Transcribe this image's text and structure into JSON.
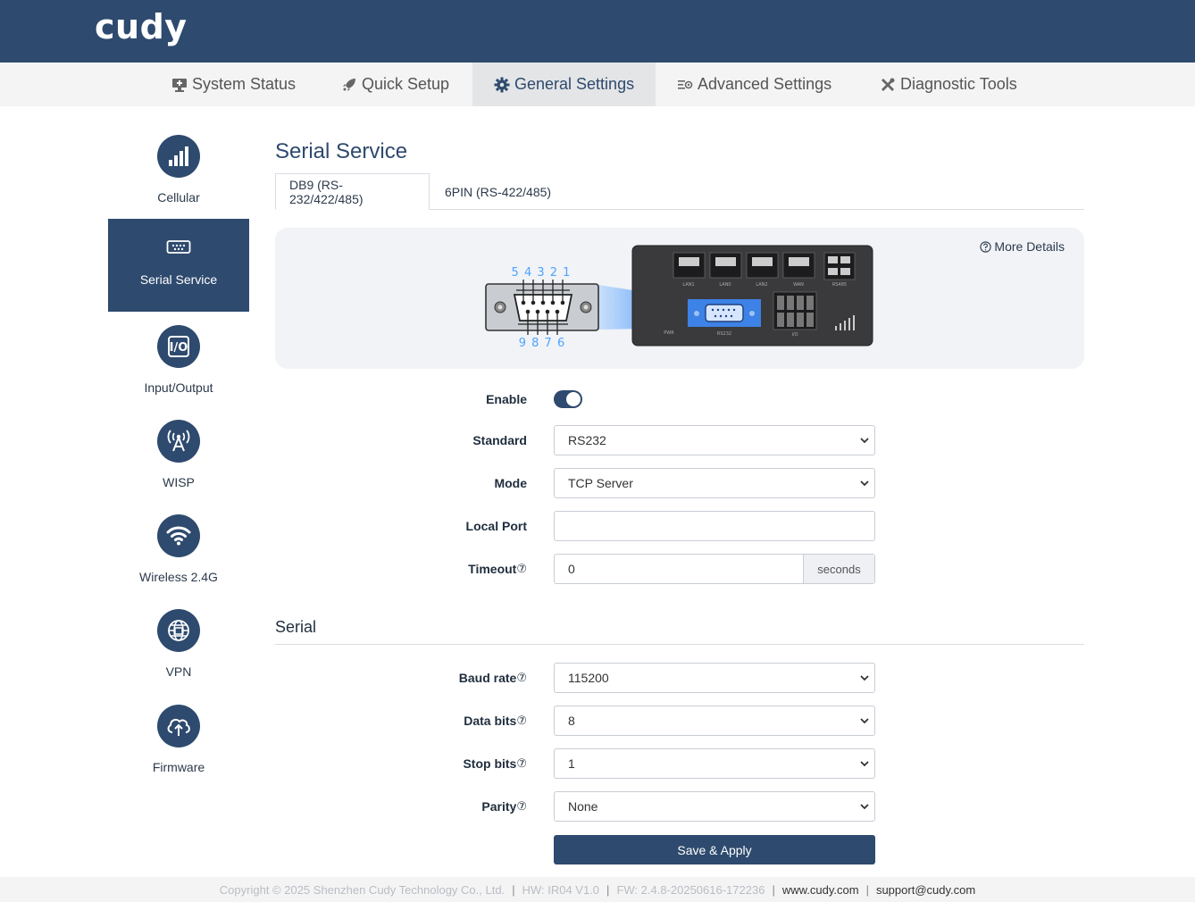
{
  "brand": {
    "logo_text": "cudy",
    "primary_color": "#2e4a6e"
  },
  "nav": {
    "items": [
      {
        "label": "System Status",
        "icon": "monitor-icon",
        "active": false
      },
      {
        "label": "Quick Setup",
        "icon": "rocket-icon",
        "active": false
      },
      {
        "label": "General Settings",
        "icon": "gear-icon",
        "active": true
      },
      {
        "label": "Advanced Settings",
        "icon": "sliders-icon",
        "active": false
      },
      {
        "label": "Diagnostic Tools",
        "icon": "tools-icon",
        "active": false
      }
    ]
  },
  "sidebar": {
    "items": [
      {
        "label": "Cellular",
        "icon": "signal-bars-icon",
        "active": false
      },
      {
        "label": "Serial Service",
        "icon": "serial-port-icon",
        "active": true
      },
      {
        "label": "Input/Output",
        "icon": "io-icon",
        "active": false
      },
      {
        "label": "WISP",
        "icon": "antenna-icon",
        "active": false
      },
      {
        "label": "Wireless 2.4G",
        "icon": "wifi-icon",
        "active": false
      },
      {
        "label": "VPN",
        "icon": "globe-icon",
        "active": false
      },
      {
        "label": "Firmware",
        "icon": "cloud-upload-icon",
        "active": false
      }
    ]
  },
  "main": {
    "title": "Serial Service",
    "tabs": [
      {
        "label": "DB9 (RS-232/422/485)",
        "active": true
      },
      {
        "label": "6PIN (RS-422/485)",
        "active": false
      }
    ],
    "diagram": {
      "more_details": "More Details",
      "pins_top": "5 4 3 2 1",
      "pins_bottom": "9 8 7 6",
      "port_labels": [
        "LAN1",
        "LAN0",
        "LAN2",
        "WAN",
        "RS485",
        "PWR",
        "RS232",
        "I/O"
      ]
    },
    "form": {
      "enable": {
        "label": "Enable",
        "value": true
      },
      "standard": {
        "label": "Standard",
        "value": "RS232"
      },
      "mode": {
        "label": "Mode",
        "value": "TCP Server"
      },
      "local_port": {
        "label": "Local Port",
        "value": ""
      },
      "timeout": {
        "label": "Timeout",
        "value": "0",
        "suffix": "seconds"
      }
    },
    "serial": {
      "heading": "Serial",
      "baud_rate": {
        "label": "Baud rate",
        "value": "115200"
      },
      "data_bits": {
        "label": "Data bits",
        "value": "8"
      },
      "stop_bits": {
        "label": "Stop bits",
        "value": "1"
      },
      "parity": {
        "label": "Parity",
        "value": "None"
      }
    },
    "save_label": "Save & Apply"
  },
  "footer": {
    "copyright": "Copyright © 2025 Shenzhen Cudy Technology Co., Ltd.",
    "hw": "HW: IR04 V1.0",
    "fw": "FW: 2.4.8-20250616-172236",
    "website": "www.cudy.com",
    "email": "support@cudy.com"
  }
}
